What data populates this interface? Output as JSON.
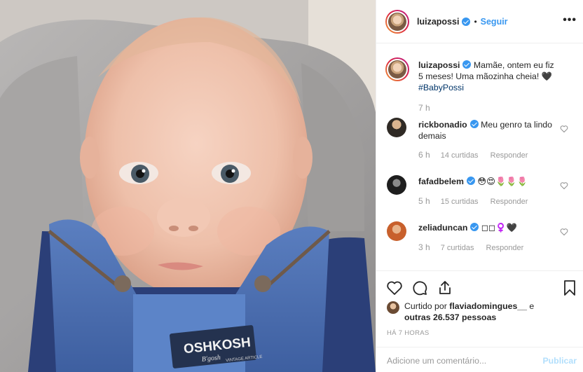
{
  "header": {
    "username": "luizapossi",
    "separator": "•",
    "follow_label": "Seguir",
    "more_icon": "more-options-icon"
  },
  "caption": {
    "username": "luizapossi",
    "text": "Mamãe, ontem eu fiz 5 meses! Uma mãozinha cheia! 🖤",
    "hashtag": "#BabyPossi",
    "time": "7 h"
  },
  "comments": [
    {
      "username": "rickbonadio",
      "text": "Meu genro ta lindo demais",
      "time": "6 h",
      "likes": "14 curtidas",
      "reply": "Responder"
    },
    {
      "username": "fafadbelem",
      "text": "😳😍🌷🌷🌷",
      "time": "5 h",
      "likes": "15 curtidas",
      "reply": "Responder"
    },
    {
      "username": "zeliaduncan",
      "text": "◻◻♀️🖤",
      "time": "3 h",
      "likes": "7 curtidas",
      "reply": "Responder"
    }
  ],
  "actions": {
    "icons": [
      "heart-icon",
      "comment-icon",
      "share-icon",
      "bookmark-icon"
    ]
  },
  "likes": {
    "prefix": "Curtido por",
    "user": "flaviadomingues__",
    "connector": "e",
    "others": "outras 26.537 pessoas"
  },
  "posted_ago": "HÁ 7 HORAS",
  "comment_box": {
    "placeholder": "Adicione um comentário...",
    "publish_label": "Publicar"
  },
  "photo": {
    "overall_brand": "OSHKOSH",
    "overall_sub": "B'gosh",
    "overall_tag": "VINTAGE ARTICLE"
  },
  "colors": {
    "accent": "#3897f0",
    "publish_disabled": "#b2dffc",
    "muted": "#999999",
    "text": "#262626"
  }
}
